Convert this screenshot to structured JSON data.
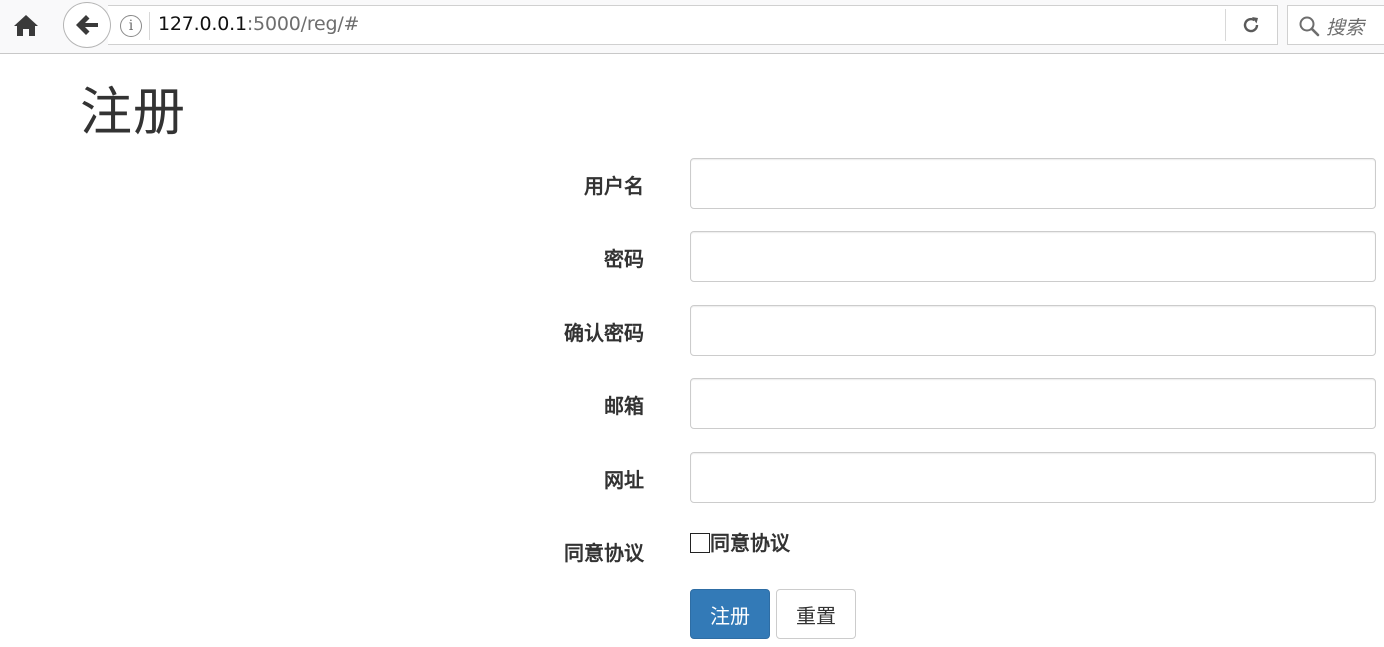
{
  "browser": {
    "url_host": "127.0.0.1",
    "url_path": ":5000/reg/#",
    "search_placeholder": "搜索"
  },
  "page": {
    "title": "注册"
  },
  "form": {
    "fields": [
      {
        "label": "用户名",
        "value": ""
      },
      {
        "label": "密码",
        "value": ""
      },
      {
        "label": "确认密码",
        "value": ""
      },
      {
        "label": "邮箱",
        "value": ""
      },
      {
        "label": "网址",
        "value": ""
      }
    ],
    "agree_label": "同意协议",
    "agree_checkbox_text": "同意协议",
    "agree_checked": false,
    "submit_label": "注册",
    "reset_label": "重置"
  },
  "colors": {
    "primary": "#337ab7",
    "text": "#333333"
  }
}
